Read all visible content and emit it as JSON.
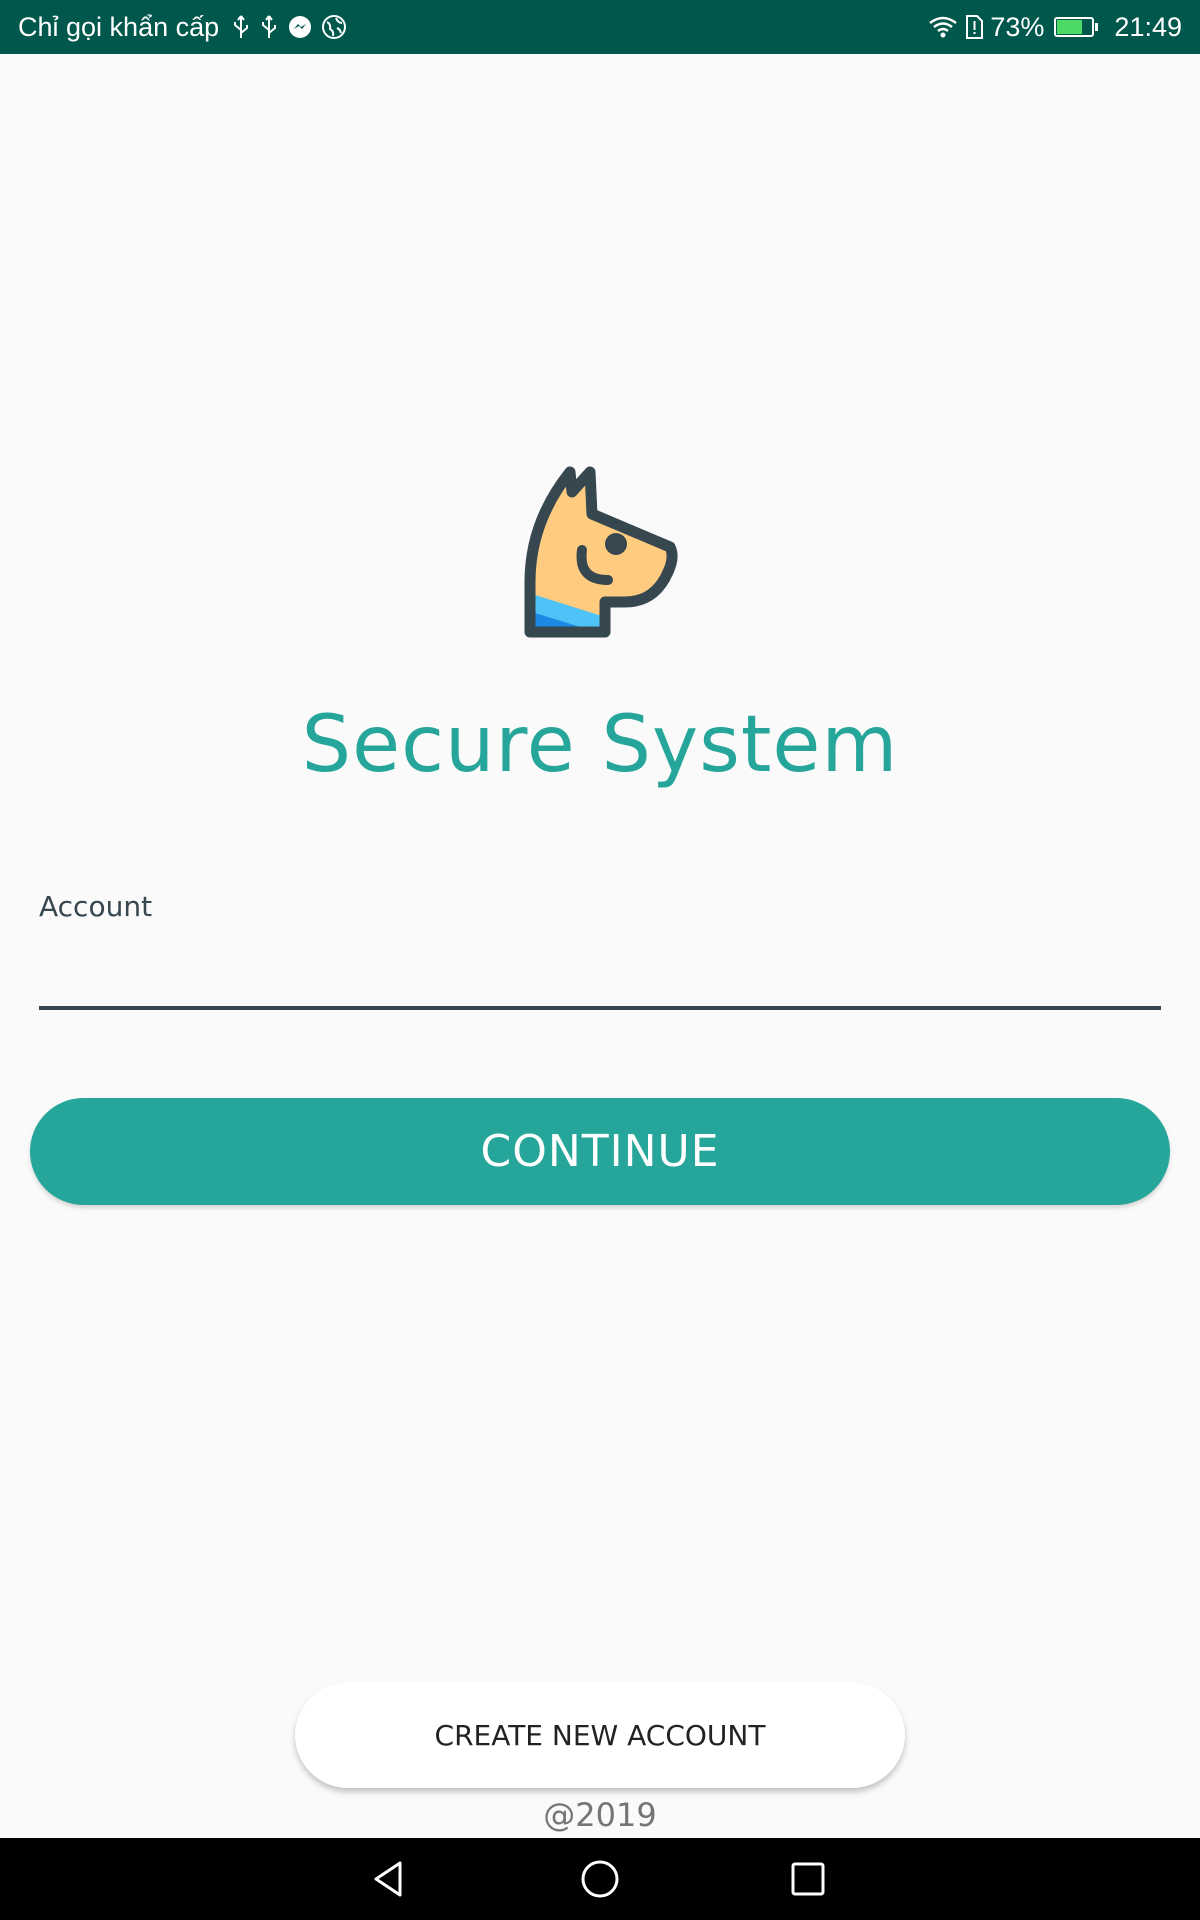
{
  "status_bar": {
    "carrier": "Chỉ gọi khẩn cấp",
    "battery_percent": "73%",
    "battery_level": 0.73,
    "time": "21:49",
    "icons": [
      "usb-icon",
      "usb-icon",
      "messenger-icon",
      "vpn-globe-icon",
      "wifi-icon",
      "sim-alert-icon",
      "battery-charging-icon"
    ]
  },
  "app": {
    "title": "Secure System",
    "logo": "dog-head-logo"
  },
  "form": {
    "account_label": "Account",
    "account_value": "",
    "continue_label": "CONTINUE"
  },
  "footer": {
    "create_account_label": "CREATE NEW ACCOUNT",
    "copyright": "@2019"
  },
  "nav_bar": {
    "icons": [
      "back-icon",
      "home-icon",
      "recents-icon"
    ]
  },
  "colors": {
    "status_bar": "#00574b",
    "accent": "#26a69a",
    "background": "#fafafa",
    "input_line": "#37474f"
  }
}
